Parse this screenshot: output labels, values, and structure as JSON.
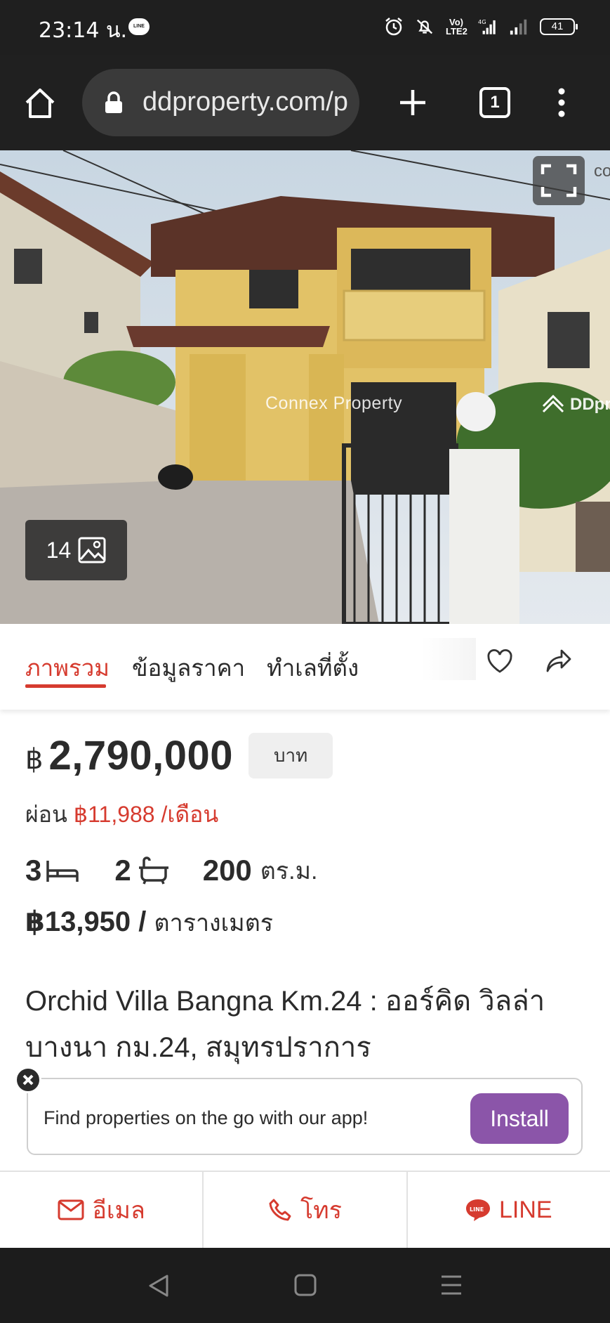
{
  "status_bar": {
    "time": "23:14 น.",
    "line_badge": "LINE",
    "volte": "Vo)\nLTE2",
    "network": "4G",
    "battery": "41"
  },
  "browser": {
    "url": "ddproperty.com/p",
    "tab_count": "1"
  },
  "hero": {
    "watermark": "Connex Property",
    "brand_watermark": "DDpro",
    "corner_text": "co",
    "photo_count": "14"
  },
  "tabs": [
    {
      "label": "ภาพรวม",
      "active": true
    },
    {
      "label": "ข้อมูลราคา",
      "active": false
    },
    {
      "label": "ทำเลที่ตั้ง",
      "active": false
    }
  ],
  "listing": {
    "currency_symbol": "฿",
    "price": "2,790,000",
    "price_unit": "บาท",
    "installment_label": "ผ่อน",
    "installment_amount": "฿11,988 /เดือน",
    "bedrooms": "3",
    "bathrooms": "2",
    "area": "200",
    "area_unit": "ตร.ม.",
    "price_per_sqm": "฿13,950 /",
    "price_per_sqm_unit": "ตารางเมตร",
    "title": "Orchid Villa Bangna Km.24 : ออร์คิด วิลล่า บางนา กม.24, สมุทรปราการ"
  },
  "app_banner": {
    "text": "Find properties on the go with our app!",
    "install_label": "Install"
  },
  "actions": {
    "email_label": "อีเมล",
    "call_label": "โทร",
    "line_label": "LINE"
  },
  "colors": {
    "accent": "#d63b2f",
    "install": "#8b55a9"
  }
}
